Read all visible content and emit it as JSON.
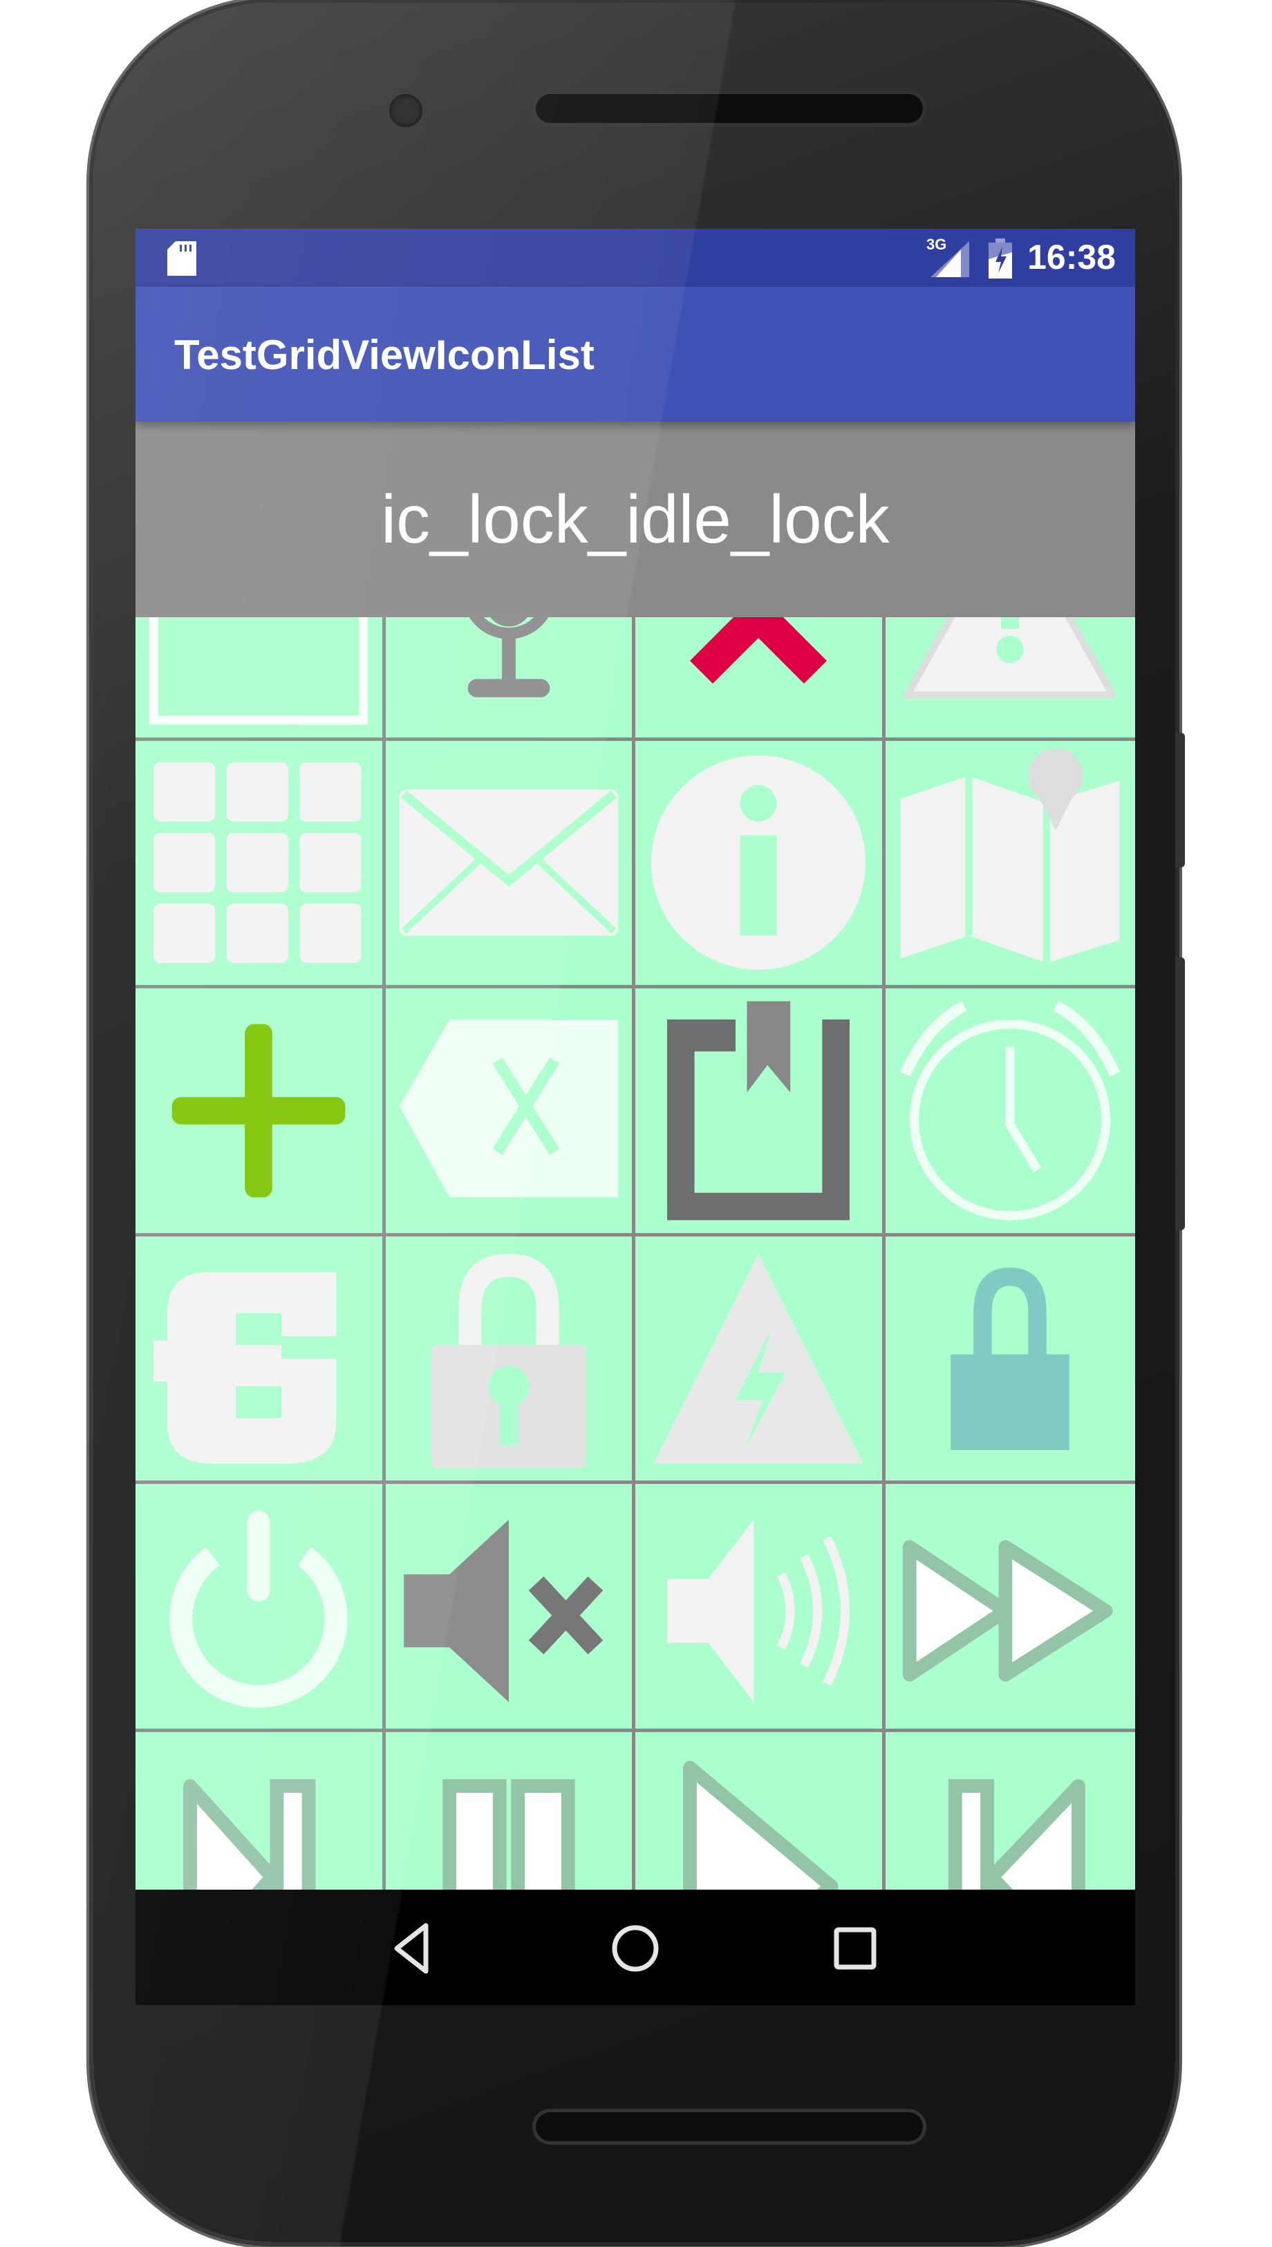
{
  "status_bar": {
    "time": "16:38",
    "network": "3G",
    "icons": [
      "sd-card-icon",
      "signal-3g-icon",
      "battery-charging-icon"
    ]
  },
  "app_bar": {
    "title": "TestGridViewIconList"
  },
  "header": {
    "selected_icon_name": "ic_lock_idle_lock"
  },
  "colors": {
    "status_bar": "#303f9f",
    "app_bar": "#3f51b5",
    "header": "#8a8a8a",
    "grid_cell": "#aaffcc",
    "grid_line": "#888888",
    "nav_bar": "#000000"
  },
  "grid": {
    "columns": 4,
    "icons": [
      "square-frame-icon",
      "microphone-icon",
      "chevron-up-icon",
      "warning-icon",
      "dialpad-icon",
      "email-icon",
      "info-icon",
      "map-icon",
      "add-icon",
      "backspace-icon",
      "bookmark-icon",
      "alarm-icon",
      "plug-icon",
      "lock-icon",
      "power-warning-icon",
      "lock-idle-icon",
      "power-icon",
      "volume-mute-icon",
      "volume-on-icon",
      "fast-forward-icon",
      "skip-next-icon",
      "pause-icon",
      "play-icon",
      "skip-previous-icon"
    ]
  },
  "nav_bar": {
    "buttons": [
      "back-icon",
      "home-icon",
      "recents-icon"
    ]
  }
}
